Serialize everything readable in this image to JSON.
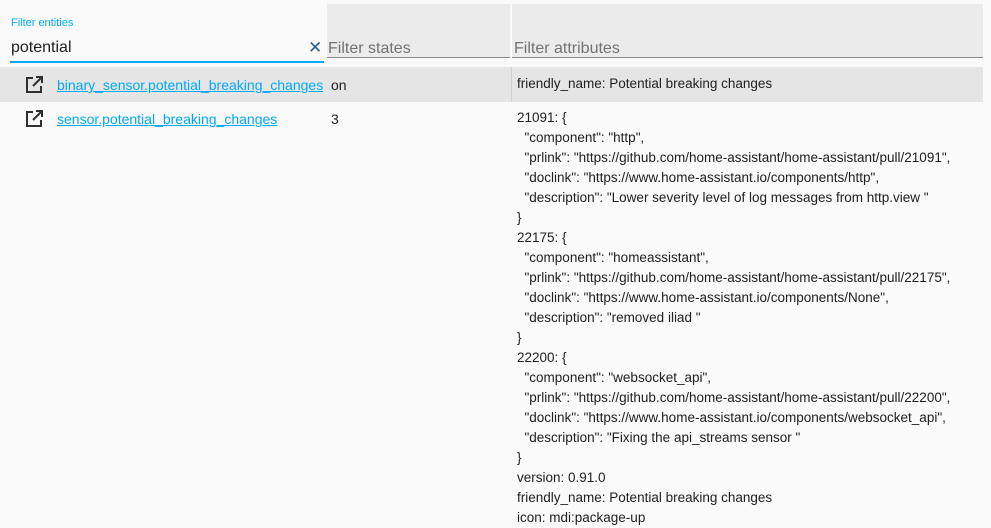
{
  "filters": {
    "entities": {
      "label": "Filter entities",
      "value": "potential"
    },
    "states": {
      "placeholder": "Filter states",
      "value": ""
    },
    "attributes": {
      "placeholder": "Filter attributes",
      "value": ""
    },
    "clear_icon": "close-icon"
  },
  "colors": {
    "accent": "#03a9f4",
    "header_bg": "#ebebeb",
    "highlight_row": "#e5e5e5",
    "clear_icon": "#2e5e8e"
  },
  "rows": [
    {
      "icon": "open-in-new-icon",
      "entity_id": "binary_sensor.potential_breaking_changes",
      "state": "on",
      "attributes": "friendly_name: Potential breaking changes"
    },
    {
      "icon": "open-in-new-icon",
      "entity_id": "sensor.potential_breaking_changes",
      "state": "3",
      "attributes": "21091: {\n  \"component\": \"http\",\n  \"prlink\": \"https://github.com/home-assistant/home-assistant/pull/21091\",\n  \"doclink\": \"https://www.home-assistant.io/components/http\",\n  \"description\": \"Lower severity level of log messages from http.view \"\n}\n22175: {\n  \"component\": \"homeassistant\",\n  \"prlink\": \"https://github.com/home-assistant/home-assistant/pull/22175\",\n  \"doclink\": \"https://www.home-assistant.io/components/None\",\n  \"description\": \"removed iliad \"\n}\n22200: {\n  \"component\": \"websocket_api\",\n  \"prlink\": \"https://github.com/home-assistant/home-assistant/pull/22200\",\n  \"doclink\": \"https://www.home-assistant.io/components/websocket_api\",\n  \"description\": \"Fixing the api_streams sensor \"\n}\nversion: 0.91.0\nfriendly_name: Potential breaking changes\nicon: mdi:package-up"
    }
  ]
}
